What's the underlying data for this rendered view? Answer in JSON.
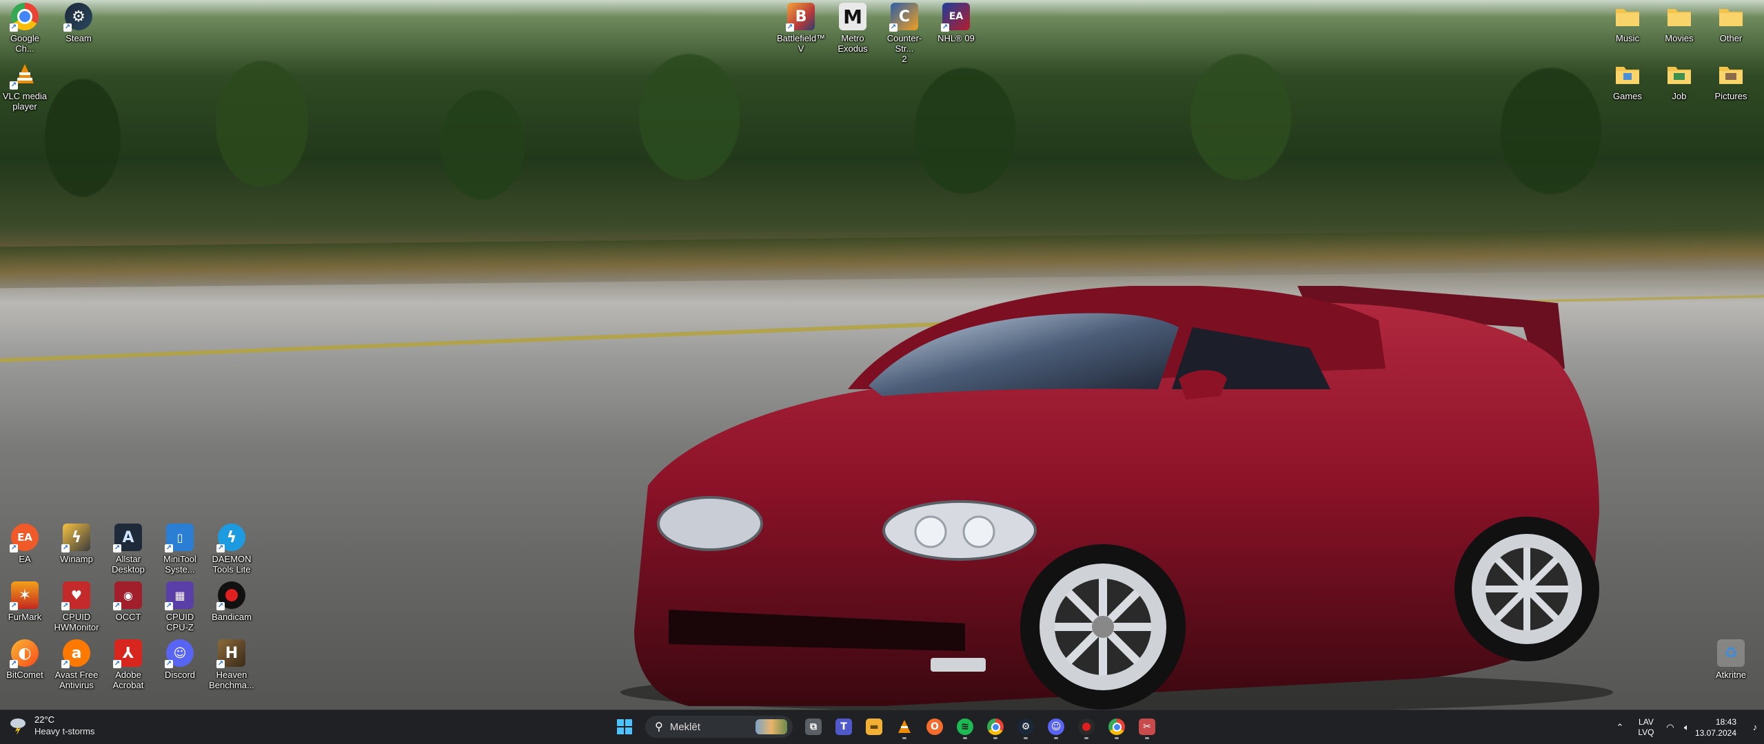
{
  "desktop": {
    "icons_top_left": [
      {
        "label": "Google Ch...",
        "icon": "chrome-icon"
      },
      {
        "label": "Steam",
        "icon": "steam-icon"
      },
      {
        "label": "VLC media\nplayer",
        "icon": "vlc-icon"
      }
    ],
    "icons_top_center": [
      {
        "label": "Battlefield™\nV",
        "icon": "battlefield-icon"
      },
      {
        "label": "Metro\nExodus",
        "icon": "metro-icon"
      },
      {
        "label": "Counter-Str...\n2",
        "icon": "counter-strike-icon"
      },
      {
        "label": "NHL® 09",
        "icon": "nhl-icon"
      }
    ],
    "icons_top_right": [
      {
        "label": "Music",
        "icon": "folder-icon"
      },
      {
        "label": "Movies",
        "icon": "folder-icon"
      },
      {
        "label": "Other",
        "icon": "folder-icon"
      },
      {
        "label": "Games",
        "icon": "folder-icon"
      },
      {
        "label": "Job",
        "icon": "folder-icon"
      },
      {
        "label": "Pictures",
        "icon": "folder-icon"
      }
    ],
    "icons_bottom_left": [
      {
        "label": "EA",
        "icon": "ea-icon"
      },
      {
        "label": "Winamp",
        "icon": "winamp-icon"
      },
      {
        "label": "Allstar\nDesktop",
        "icon": "allstar-icon"
      },
      {
        "label": "MiniTool\nSyste...",
        "icon": "minitool-icon"
      },
      {
        "label": "DAEMON\nTools Lite",
        "icon": "daemon-tools-icon"
      },
      {
        "label": "FurMark",
        "icon": "furmark-icon"
      },
      {
        "label": "CPUID\nHWMonitor",
        "icon": "hwmonitor-icon"
      },
      {
        "label": "OCCT",
        "icon": "occt-icon"
      },
      {
        "label": "CPUID\nCPU-Z",
        "icon": "cpuz-icon"
      },
      {
        "label": "Bandicam",
        "icon": "bandicam-icon"
      },
      {
        "label": "BitComet",
        "icon": "bitcomet-icon"
      },
      {
        "label": "Avast Free\nAntivirus",
        "icon": "avast-icon"
      },
      {
        "label": "Adobe\nAcrobat",
        "icon": "acrobat-icon"
      },
      {
        "label": "Discord",
        "icon": "discord-icon"
      },
      {
        "label": "Heaven\nBenchma...",
        "icon": "heaven-benchmark-icon"
      }
    ],
    "recycle_bin": {
      "label": "Atkritne",
      "icon": "recycle-bin-icon"
    }
  },
  "taskbar": {
    "weather": {
      "temp": "22°C",
      "desc": "Heavy t-storms",
      "icon": "thunderstorm-icon"
    },
    "search_placeholder": "Meklēt",
    "apps": [
      {
        "name": "task-view",
        "icon": "task-view-icon",
        "color": "#5b5f66"
      },
      {
        "name": "teams",
        "icon": "teams-icon",
        "color": "#5059c9"
      },
      {
        "name": "file-explorer",
        "icon": "file-explorer-icon",
        "color": "#f2b134"
      },
      {
        "name": "vlc",
        "icon": "vlc-icon",
        "color": "#f08a00"
      },
      {
        "name": "origin",
        "icon": "origin-icon",
        "color": "#f56c2d"
      },
      {
        "name": "spotify",
        "icon": "spotify-icon",
        "color": "#1db954"
      },
      {
        "name": "chrome",
        "icon": "chrome-icon",
        "color": "#4285f4"
      },
      {
        "name": "steam",
        "icon": "steam-icon",
        "color": "#1b2838"
      },
      {
        "name": "discord",
        "icon": "discord-icon",
        "color": "#5865f2"
      },
      {
        "name": "recorder",
        "icon": "record-icon",
        "color": "#2a2a2a"
      },
      {
        "name": "chrome-2",
        "icon": "chrome-icon",
        "color": "#4285f4"
      },
      {
        "name": "snipping",
        "icon": "snipping-tool-icon",
        "color": "#c94a4a"
      }
    ],
    "tray": {
      "lang_top": "LAV",
      "lang_bottom": "LVQ",
      "time": "18:43",
      "date": "13.07.2024"
    }
  }
}
